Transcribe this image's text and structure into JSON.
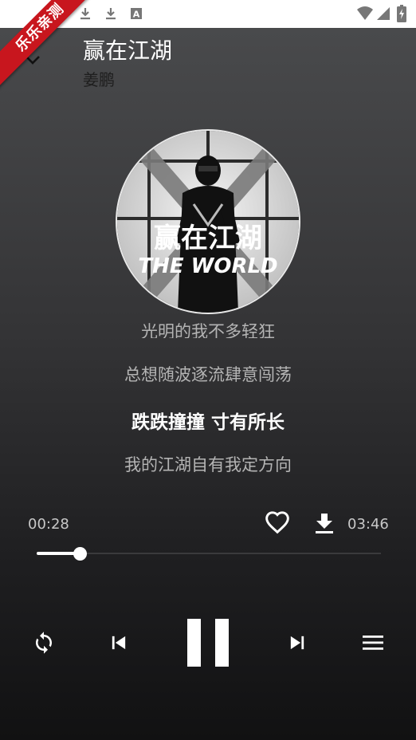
{
  "app": {
    "badge_text": "乐乐亲测"
  },
  "status_bar": {
    "icons": [
      "download-icon",
      "download-icon",
      "text-a-icon",
      "wifi-icon",
      "cellular-icon",
      "battery-icon"
    ]
  },
  "song": {
    "title": "赢在江湖",
    "artist": "姜鹏"
  },
  "cover": {
    "title_text": "赢在江湖",
    "subtitle_text": "THE WORLD"
  },
  "lyrics": {
    "partial": "光明的我不多轻狂",
    "lines": [
      "总想随波逐流肆意闯荡",
      "跌跌撞撞 寸有所长",
      "我的江湖自有我定方向"
    ],
    "active_index": 1
  },
  "playback": {
    "current_time": "00:28",
    "total_time": "03:46",
    "progress": 0.1239,
    "is_playing": true
  },
  "controls": [
    "repeat-icon",
    "previous-icon",
    "pause-icon",
    "next-icon",
    "playlist-icon"
  ],
  "colors": {
    "badge": "#c8161e",
    "background_top": "#4b4c4e",
    "background_bottom": "#111112"
  }
}
